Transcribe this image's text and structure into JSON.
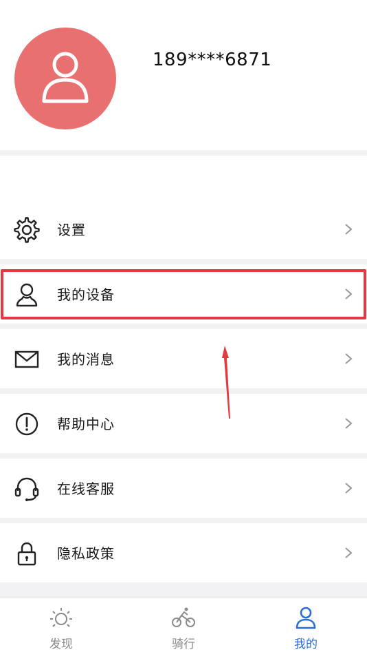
{
  "profile": {
    "phone": "189****6871",
    "avatar_icon": "user-icon",
    "avatar_color": "#e87070"
  },
  "menu": {
    "items": [
      {
        "label": "设置",
        "icon": "gear-icon"
      },
      {
        "label": "我的设备",
        "icon": "person-outline-icon"
      },
      {
        "label": "我的消息",
        "icon": "envelope-icon"
      },
      {
        "label": "帮助中心",
        "icon": "exclamation-circle-icon"
      },
      {
        "label": "在线客服",
        "icon": "headset-icon"
      },
      {
        "label": "隐私政策",
        "icon": "lock-icon"
      }
    ]
  },
  "tabbar": {
    "tabs": [
      {
        "label": "发现",
        "icon": "sun-icon",
        "active": false
      },
      {
        "label": "骑行",
        "icon": "bicycle-icon",
        "active": false
      },
      {
        "label": "我的",
        "icon": "user-icon",
        "active": true
      }
    ],
    "active_color": "#2a6cd6",
    "inactive_color": "#8a8a8a"
  },
  "annotation": {
    "highlight_color": "#e23a3f"
  }
}
